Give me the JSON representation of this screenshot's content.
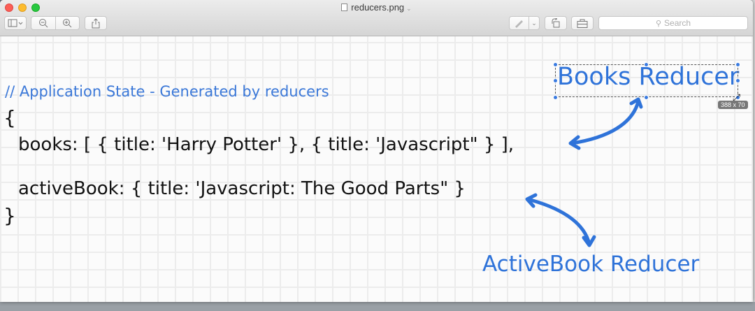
{
  "window": {
    "title": "reducers.png"
  },
  "toolbar": {
    "search_placeholder": "Search"
  },
  "document": {
    "comment": "// Application State - Generated by reducers",
    "line1": "{",
    "line2": "books: [ { title: 'Harry Potter' }, { title: 'Javascript\" } ],",
    "line3": "activeBook: { title: 'Javascript: The Good Parts\" }",
    "line4": "}"
  },
  "annotations": {
    "books_reducer": "Books Reducer",
    "activebook_reducer": "ActiveBook Reducer",
    "selection_size": "388 x 70"
  },
  "colors": {
    "annotation_blue": "#2f73d9",
    "comment_blue": "#3b78d8",
    "selection_handle": "#3a7be0"
  }
}
